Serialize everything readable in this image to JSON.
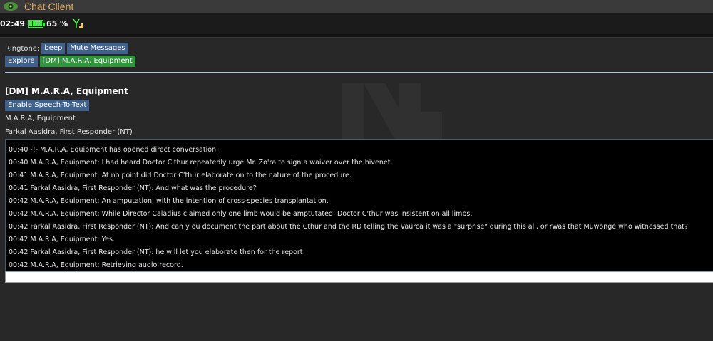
{
  "app": {
    "title": "Chat Client"
  },
  "status": {
    "time": "02:49",
    "battery": "65 %"
  },
  "controls": {
    "ringtone_label": "Ringtone:",
    "ringtone_button": "beep",
    "mute_button": "Mute Messages",
    "explore_button": "Explore",
    "active_chat_tab": "[DM] M.A.R.A, Equipment"
  },
  "conversation": {
    "title": "[DM] M.A.R.A, Equipment",
    "speech_button": "Enable Speech-To-Text",
    "participants": [
      "M.A.R.A, Equipment",
      "Farkal Aasidra, First Responder (NT)"
    ],
    "messages": [
      "00:40 -!- M.A.R.A, Equipment has opened direct conversation.",
      "00:40 M.A.R.A, Equipment: I had heard Doctor C'thur repeatedly urge Mr. Zo'ra to sign a waiver over the hivenet.",
      "00:41 M.A.R.A, Equipment: At no point did Doctor C'thur elaborate on to the nature of the procedure.",
      "00:41 Farkal Aasidra, First Responder (NT): And what was the procedure?",
      "00:42 M.A.R.A, Equipment: An amputation, with the intention of cross-species transplantation.",
      "00:42 M.A.R.A, Equipment: While Director Caladius claimed only one limb would be amptutated, Doctor C'thur was insistent on all limbs.",
      "00:42 Farkal Aasidra, First Responder (NT): And can y ou document the part about the Cthur and the RD telling the Vaurca it was a \"surprise\" during this all, or rwas that Muwonge who witnessed that?",
      "00:42 M.A.R.A, Equipment: Yes.",
      "00:42 Farkal Aasidra, First Responder (NT): he will let you elaborate then for the report",
      "00:42 M.A.R.A, Equipment: Retrieving audio record."
    ],
    "input_value": ""
  },
  "colors": {
    "title_accent": "#e0a860",
    "button_blue": "#40628a",
    "button_green": "#2f943c",
    "battery_green": "#33ff33"
  },
  "icons": {
    "app": "eye-icon",
    "battery": "battery-icon",
    "signal": "signal-antenna-icon"
  }
}
